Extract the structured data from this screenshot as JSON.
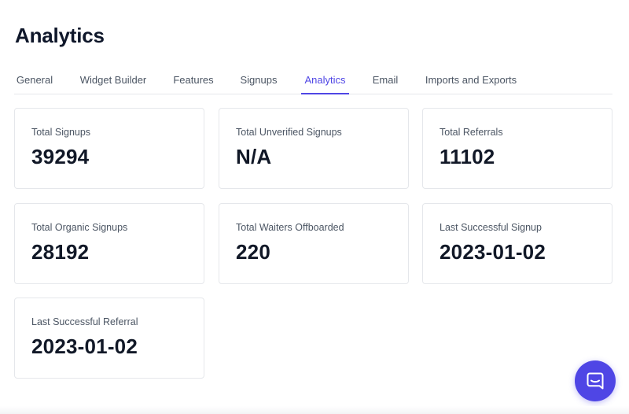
{
  "page": {
    "title": "Analytics"
  },
  "tabs": [
    {
      "label": "General",
      "active": false
    },
    {
      "label": "Widget Builder",
      "active": false
    },
    {
      "label": "Features",
      "active": false
    },
    {
      "label": "Signups",
      "active": false
    },
    {
      "label": "Analytics",
      "active": true
    },
    {
      "label": "Email",
      "active": false
    },
    {
      "label": "Imports and Exports",
      "active": false
    }
  ],
  "stats": [
    {
      "label": "Total Signups",
      "value": "39294"
    },
    {
      "label": "Total Unverified Signups",
      "value": "N/A"
    },
    {
      "label": "Total Referrals",
      "value": "11102"
    },
    {
      "label": "Total Organic Signups",
      "value": "28192"
    },
    {
      "label": "Total Waiters Offboarded",
      "value": "220"
    },
    {
      "label": "Last Successful Signup",
      "value": "2023-01-02"
    },
    {
      "label": "Last Successful Referral",
      "value": "2023-01-02"
    }
  ],
  "chat": {
    "icon": "chat-bubble-icon"
  },
  "colors": {
    "accent": "#4f46e5",
    "text": "#111827",
    "muted": "#4b5563",
    "border": "#e5e7eb"
  }
}
